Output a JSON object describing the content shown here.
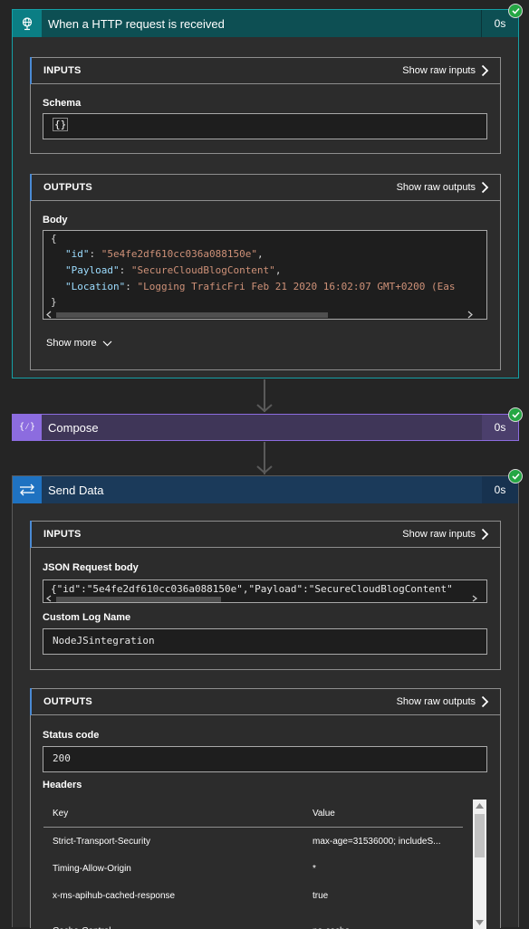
{
  "http_step": {
    "title": "When a HTTP request is received",
    "duration": "0s",
    "inputs": {
      "label": "INPUTS",
      "raw_label": "Show raw inputs",
      "schema_label": "Schema",
      "schema_value": "{}"
    },
    "outputs": {
      "label": "OUTPUTS",
      "raw_label": "Show raw outputs",
      "body_label": "Body",
      "body_lines": {
        "open": "{",
        "id_key": "\"id\"",
        "id_val": "\"5e4fe2df610cc036a088150e\"",
        "payload_key": "\"Payload\"",
        "payload_val": "\"SecureCloudBlogContent\"",
        "location_key": "\"Location\"",
        "location_val": "\"Logging TraficFri Feb 21 2020 16:02:07 GMT+0200 (Eas",
        "close": "}"
      }
    },
    "show_more": "Show more"
  },
  "compose_step": {
    "title": "Compose",
    "duration": "0s",
    "icon_text": "{⁄}"
  },
  "send_step": {
    "title": "Send Data",
    "duration": "0s",
    "inputs": {
      "label": "INPUTS",
      "raw_label": "Show raw inputs",
      "json_label": "JSON Request body",
      "json_value": "{\"id\":\"5e4fe2df610cc036a088150e\",\"Payload\":\"SecureCloudBlogContent\"",
      "log_label": "Custom Log Name",
      "log_value": "NodeJSintegration"
    },
    "outputs": {
      "label": "OUTPUTS",
      "raw_label": "Show raw outputs",
      "status_label": "Status code",
      "status_value": "200",
      "headers_label": "Headers",
      "headers_columns": {
        "key": "Key",
        "value": "Value"
      },
      "headers_rows": [
        {
          "key": "Strict-Transport-Security",
          "value": "max-age=31536000; includeS..."
        },
        {
          "key": "Timing-Allow-Origin",
          "value": "*"
        },
        {
          "key": "x-ms-apihub-cached-response",
          "value": "true"
        },
        {
          "key": "Cache-Control",
          "value": "no-cache"
        }
      ]
    }
  },
  "colors": {
    "http_accent": "#0b7e84",
    "http_border": "#15a0a6",
    "compose_accent": "#8c6cdf",
    "compose_header": "#3f3658",
    "send_accent": "#1f72c1",
    "send_header": "#1b3a5a",
    "success": "#25a744"
  },
  "icons": {
    "http": "globe-request-icon",
    "compose": "compose-braces-icon",
    "send": "send-data-arrows-icon",
    "chevron": "chevron-right-icon",
    "success": "check-circle-icon"
  }
}
